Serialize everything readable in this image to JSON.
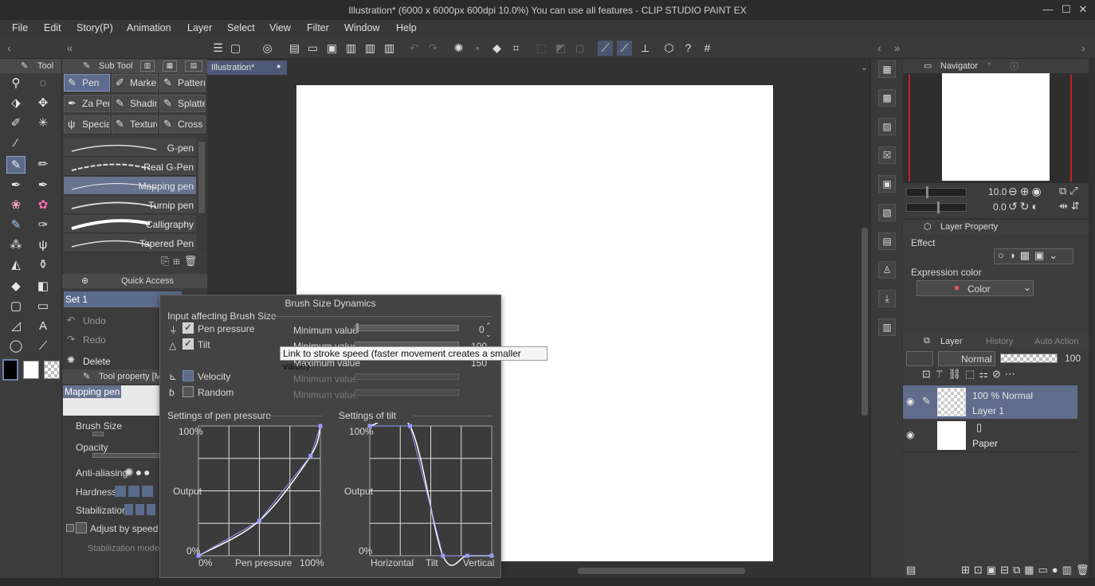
{
  "window": {
    "title": "Illustration* (6000 x 6000px 600dpi 10.0%)  You can use all features - CLIP STUDIO PAINT EX",
    "minimize": "—",
    "maximize": "☐",
    "close": "✕"
  },
  "menu": [
    "File",
    "Edit",
    "Story(P)",
    "Animation",
    "Layer",
    "Select",
    "View",
    "Filter",
    "Window",
    "Help"
  ],
  "tool_panel": {
    "tab": "Tool"
  },
  "sub_tool_panel": {
    "tab": "Sub Tool",
    "groups": [
      "Pen",
      "Marker",
      "Pattern",
      "Za Pen",
      "Shading",
      "Splatter",
      "Special",
      "Texture",
      "Cross"
    ],
    "brushes": [
      "G-pen",
      "Real G-Pen",
      "Mapping pen",
      "Turnip pen",
      "Calligraphy",
      "Tapered Pen"
    ]
  },
  "quick_access": {
    "tab": "Quick Access",
    "set": "Set 1",
    "undo": "Undo",
    "redo": "Redo",
    "delete": "Delete"
  },
  "tool_property": {
    "tab": "Tool property [Ma",
    "preview_name": "Mapping pen",
    "brush_size": "Brush Size",
    "opacity": "Opacity",
    "anti_aliasing": "Anti-aliasing",
    "hardness": "Hardness",
    "stabilization": "Stabilization",
    "adjust_by_speed": "Adjust by speed",
    "stabilization_mode": "Stabilization mode"
  },
  "canvas": {
    "tab_label": "Illustration*"
  },
  "dialog": {
    "title": "Brush Size Dynamics",
    "input_section": "Input affecting Brush Size",
    "inputs": [
      {
        "label": "Pen pressure",
        "checked": true
      },
      {
        "label": "Tilt",
        "checked": true
      },
      {
        "label": "Velocity",
        "checked": false
      },
      {
        "label": "Random",
        "checked": false
      }
    ],
    "min_value_label": "Minimum value",
    "min_value": "0",
    "tilt_min_label": "Minimum value",
    "tilt_min_value": "100",
    "max_value_label": "Maximum value",
    "max_value": "150",
    "velocity_min_label": "Minimum value",
    "random_min_label": "Minimum value",
    "tooltip": "Link to stroke speed (faster movement creates a smaller value)",
    "pressure_graph": {
      "title": "Settings of pen pressure",
      "y_top": "100%",
      "y_mid": "Output",
      "y_bottom": "0%",
      "x_left": "0%",
      "x_mid": "Pen pressure",
      "x_right": "100%",
      "curve": [
        [
          0,
          0
        ],
        [
          0.5,
          0.27
        ],
        [
          0.92,
          0.77
        ],
        [
          1,
          1
        ]
      ]
    },
    "tilt_graph": {
      "title": "Settings of tilt",
      "y_top": "100%",
      "y_mid": "Output",
      "y_bottom": "0%",
      "x_left": "Horizontal",
      "x_mid": "Tilt",
      "x_right": "Vertical",
      "curve": [
        [
          0,
          1
        ],
        [
          0.33,
          1
        ],
        [
          0.6,
          0
        ],
        [
          0.8,
          0
        ],
        [
          1,
          0
        ]
      ]
    }
  },
  "navigator": {
    "tab": "Navigator",
    "zoom": "10.0",
    "rotation": "0.0"
  },
  "layer_property": {
    "tab": "Layer Property",
    "effect": "Effect",
    "expression_color": "Expression color",
    "color_value": "Color"
  },
  "layer_panel": {
    "tabs": [
      "Layer",
      "History",
      "Auto Action"
    ],
    "blend_mode": "Normal",
    "opacity": "100",
    "layers": [
      {
        "meta": "100 % Normal",
        "name": "Layer 1"
      },
      {
        "meta": "",
        "name": "Paper"
      }
    ]
  }
}
